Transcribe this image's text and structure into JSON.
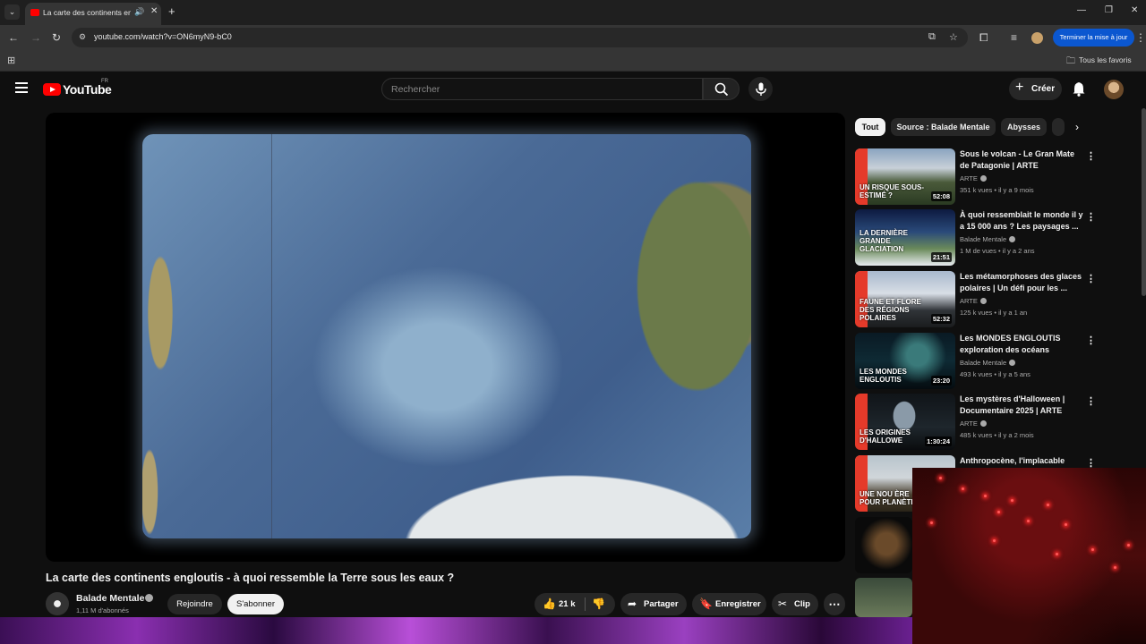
{
  "browser": {
    "tab_title": "La carte des continents engloutis",
    "tab_audio_icon": "speaker-icon",
    "url": "youtube.com/watch?v=ON6myN9-bC0",
    "update_button": "Terminer la mise à jour",
    "bookmarks_all": "Tous les favoris"
  },
  "header": {
    "logo_text": "YouTube",
    "country_code": "FR",
    "search_placeholder": "Rechercher",
    "create_label": "Créer"
  },
  "video": {
    "title": "La carte des continents engloutis - à quoi ressemble la Terre sous les eaux ?",
    "channel_name": "Balade Mentale",
    "subscribers": "1,11 M d'abonnés",
    "join_label": "Rejoindre",
    "subscribe_label": "S'abonner",
    "likes": "21 k",
    "share_label": "Partager",
    "save_label": "Enregistrer",
    "clip_label": "Clip"
  },
  "chips": [
    {
      "label": "Tout",
      "active": true
    },
    {
      "label": "Source : Balade Mentale",
      "active": false
    },
    {
      "label": "Abysses",
      "active": false
    }
  ],
  "recommendations": [
    {
      "title": "Sous le volcan - Le Gran Mate de Patagonie | ARTE",
      "channel": "ARTE",
      "meta": "351 k vues • il y a 9 mois",
      "duration": "52:08",
      "thumb_text": "UN RISQUE SOUS-ESTIMÉ ?"
    },
    {
      "title": "À quoi ressemblait le monde il y a 15 000 ans ? Les paysages ...",
      "channel": "Balade Mentale",
      "meta": "1 M de vues • il y a 2 ans",
      "duration": "21:51",
      "thumb_text": "LA DERNIÈRE GRANDE GLACIATION"
    },
    {
      "title": "Les métamorphoses des glaces polaires | Un défi pour les ...",
      "channel": "ARTE",
      "meta": "125 k vues • il y a 1 an",
      "duration": "52:32",
      "thumb_text": "FAUNE ET FLORE DES RÉGIONS POLAIRES"
    },
    {
      "title": "Les MONDES ENGLOUTIS exploration des océans",
      "channel": "Balade Mentale",
      "meta": "493 k vues • il y a 5 ans",
      "duration": "23:20",
      "thumb_text": "LES MONDES ENGLOUTIS"
    },
    {
      "title": "Les mystères d'Halloween | Documentaire 2025 | ARTE",
      "channel": "ARTE",
      "meta": "485 k vues • il y a 2 mois",
      "duration": "1:30:24",
      "thumb_text": "LES ORIGINES D'HALLOWE"
    },
    {
      "title": "Anthropocène, l'implacable",
      "channel": "",
      "meta": "",
      "duration": "",
      "thumb_text": "UNE NOU ÈRE POUR PLANÈTE"
    }
  ]
}
